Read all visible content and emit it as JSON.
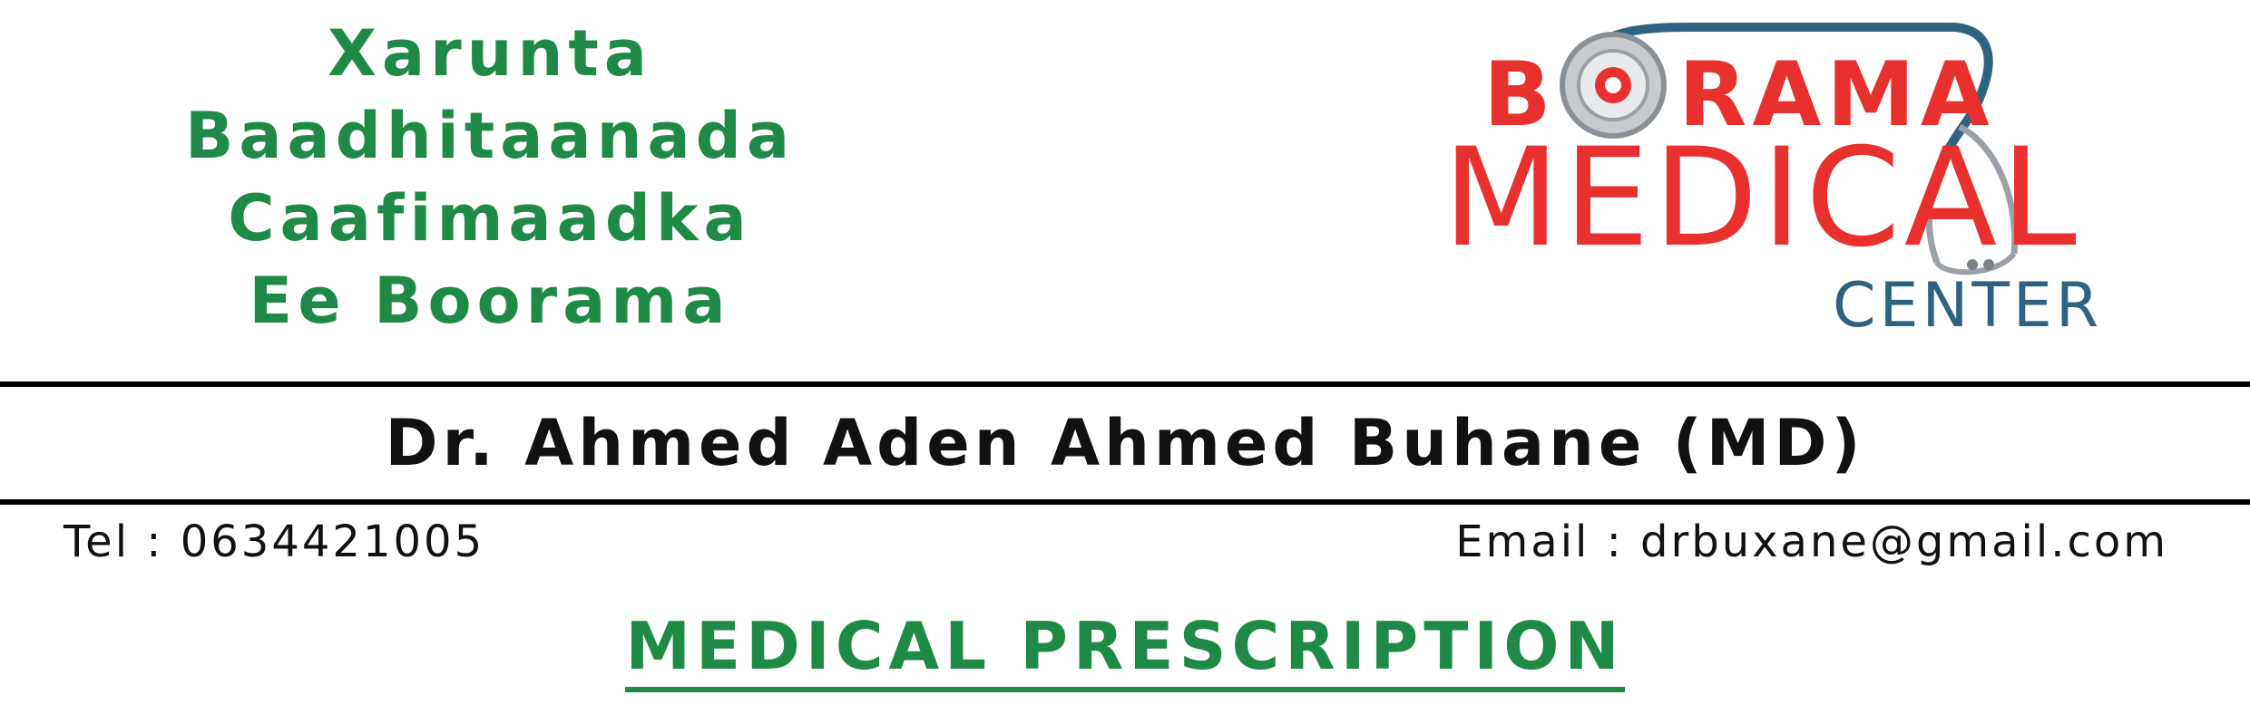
{
  "header": {
    "somali_name_lines": [
      "Xarunta",
      "Baadhitaanada",
      "Caafimaadka",
      "Ee Boorama"
    ],
    "logo": {
      "line1": "BORAMA",
      "line2": "MEDICAL",
      "line3": "CENTER",
      "icon": "stethoscope-icon",
      "colors": {
        "red": "#e8312f",
        "teal": "#2d6280",
        "gray": "#9aa0a6"
      }
    }
  },
  "doctor": {
    "name": "Dr. Ahmed Aden Ahmed Buhane (MD)"
  },
  "contact": {
    "tel": "Tel : 0634421005",
    "email": "Email : drbuxane@gmail.com"
  },
  "document": {
    "title": "MEDICAL PRESCRIPTION"
  },
  "colors": {
    "green": "#1f8a45",
    "black": "#000000"
  }
}
